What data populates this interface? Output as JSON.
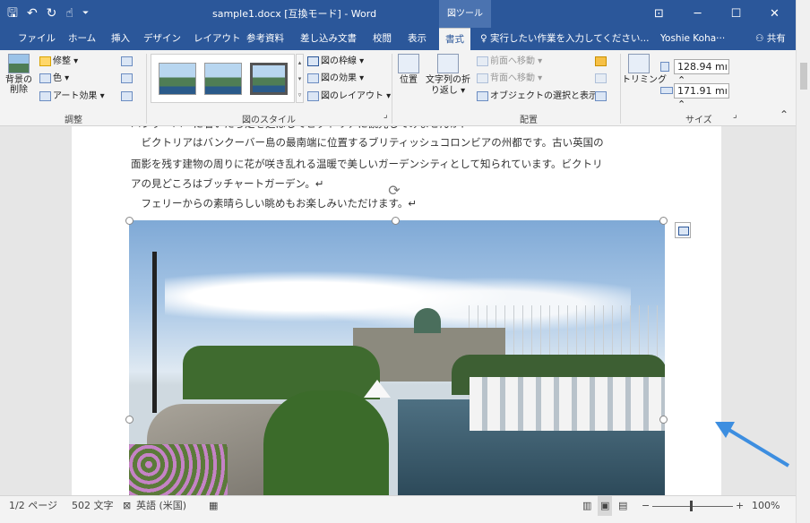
{
  "titlebar": {
    "qat": {
      "save_icon": "🖫",
      "undo_icon": "↶",
      "redo_icon": "↻",
      "touch_icon": "☝",
      "more_icon": "⏷"
    },
    "document_title": "sample1.docx [互換モード] - Word",
    "context_tab_label": "図ツール",
    "window": {
      "ribbon_display_icon": "⊡",
      "minimize_icon": "─",
      "maximize_icon": "☐",
      "close_icon": "✕"
    }
  },
  "tabs": [
    {
      "label": "ファイル"
    },
    {
      "label": "ホーム"
    },
    {
      "label": "挿入"
    },
    {
      "label": "デザイン"
    },
    {
      "label": "レイアウト"
    },
    {
      "label": "参考資料"
    },
    {
      "label": "差し込み文書"
    },
    {
      "label": "校閲"
    },
    {
      "label": "表示"
    },
    {
      "label": "書式",
      "active": true
    }
  ],
  "tellme": {
    "icon": "♀",
    "text": "実行したい作業を入力してください..."
  },
  "user": "Yoshie Koha···",
  "share": {
    "icon": "⚇",
    "label": "共有"
  },
  "ribbon": {
    "adjust": {
      "remove_bg": "背景の\n削除",
      "corrections": "修整 ▾",
      "color": "色 ▾",
      "artistic": "アート効果 ▾",
      "group_label": "調整"
    },
    "styles": {
      "border": "図の枠線 ▾",
      "effects": "図の効果 ▾",
      "layout": "図のレイアウト ▾",
      "group_label": "図のスタイル",
      "launcher": "⌟"
    },
    "arrange": {
      "position": "位置",
      "wrap": "文字列の折\nり返し ▾",
      "forward": "前面へ移動 ▾",
      "backward": "背面へ移動 ▾",
      "selection": "オブジェクトの選択と表示",
      "group_label": "配置"
    },
    "size": {
      "crop": "トリミング",
      "height": "128.94 mı ⌃",
      "width": "171.91 mı ⌃",
      "group_label": "サイズ",
      "launcher": "⌟",
      "collapse": "⌃"
    }
  },
  "document": {
    "lines": [
      "バンクーバーに着いたら足を延ばしてビクトリアに観光してみませんか？↵",
      "　ビクトリアはバンクーバー島の最南端に位置するブリティッシュコロンビアの州都です。古い英国の",
      "面影を残す建物の周りに花が咲き乱れる温暖で美しいガーデンシティとして知られています。ビクトリ",
      "アの見どころはブッチャートガーデン。↵",
      "　フェリーからの素晴らしい眺めもお楽しみいただけます。↵"
    ],
    "rotate_icon": "⟳"
  },
  "status": {
    "page": "1/2 ページ",
    "words": "502 文字",
    "proof_icon": "⊠",
    "language": "英語 (米国)",
    "macro_icon": "▦",
    "view_read_icon": "▥",
    "view_print_icon": "▣",
    "view_web_icon": "▤",
    "zoom_minus": "−",
    "zoom_plus": "+",
    "zoom": "100%"
  },
  "colors": {
    "accent": "#2b579a",
    "arrow": "#3d8ee0"
  }
}
